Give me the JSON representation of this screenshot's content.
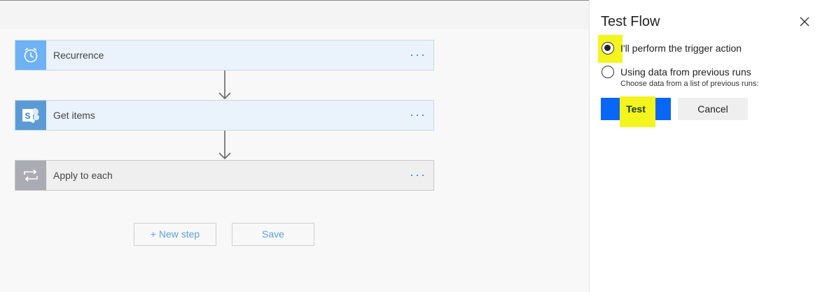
{
  "canvas": {
    "steps": [
      {
        "label": "Recurrence",
        "icon": "clock-icon",
        "more": "···"
      },
      {
        "label": "Get items",
        "icon": "sharepoint-icon",
        "more": "···"
      },
      {
        "label": "Apply to each",
        "icon": "loop-icon",
        "more": "···"
      }
    ],
    "new_step_label": "+ New step",
    "save_label": "Save"
  },
  "panel": {
    "title": "Test Flow",
    "options": [
      {
        "label": "I'll perform the trigger action",
        "selected": true
      },
      {
        "label": "Using data from previous runs",
        "sublabel": "Choose data from a list of previous runs:",
        "selected": false
      }
    ],
    "test_label": "Test",
    "cancel_label": "Cancel"
  },
  "colors": {
    "recurrence_icon_bg": "#6fb1f5",
    "sharepoint_icon_bg": "#5b9bd5",
    "loop_icon_bg": "#a9adb3",
    "test_button_bg": "#0a66f5",
    "highlight": "#f4f41e",
    "ellipsis": "#2b88d8"
  }
}
